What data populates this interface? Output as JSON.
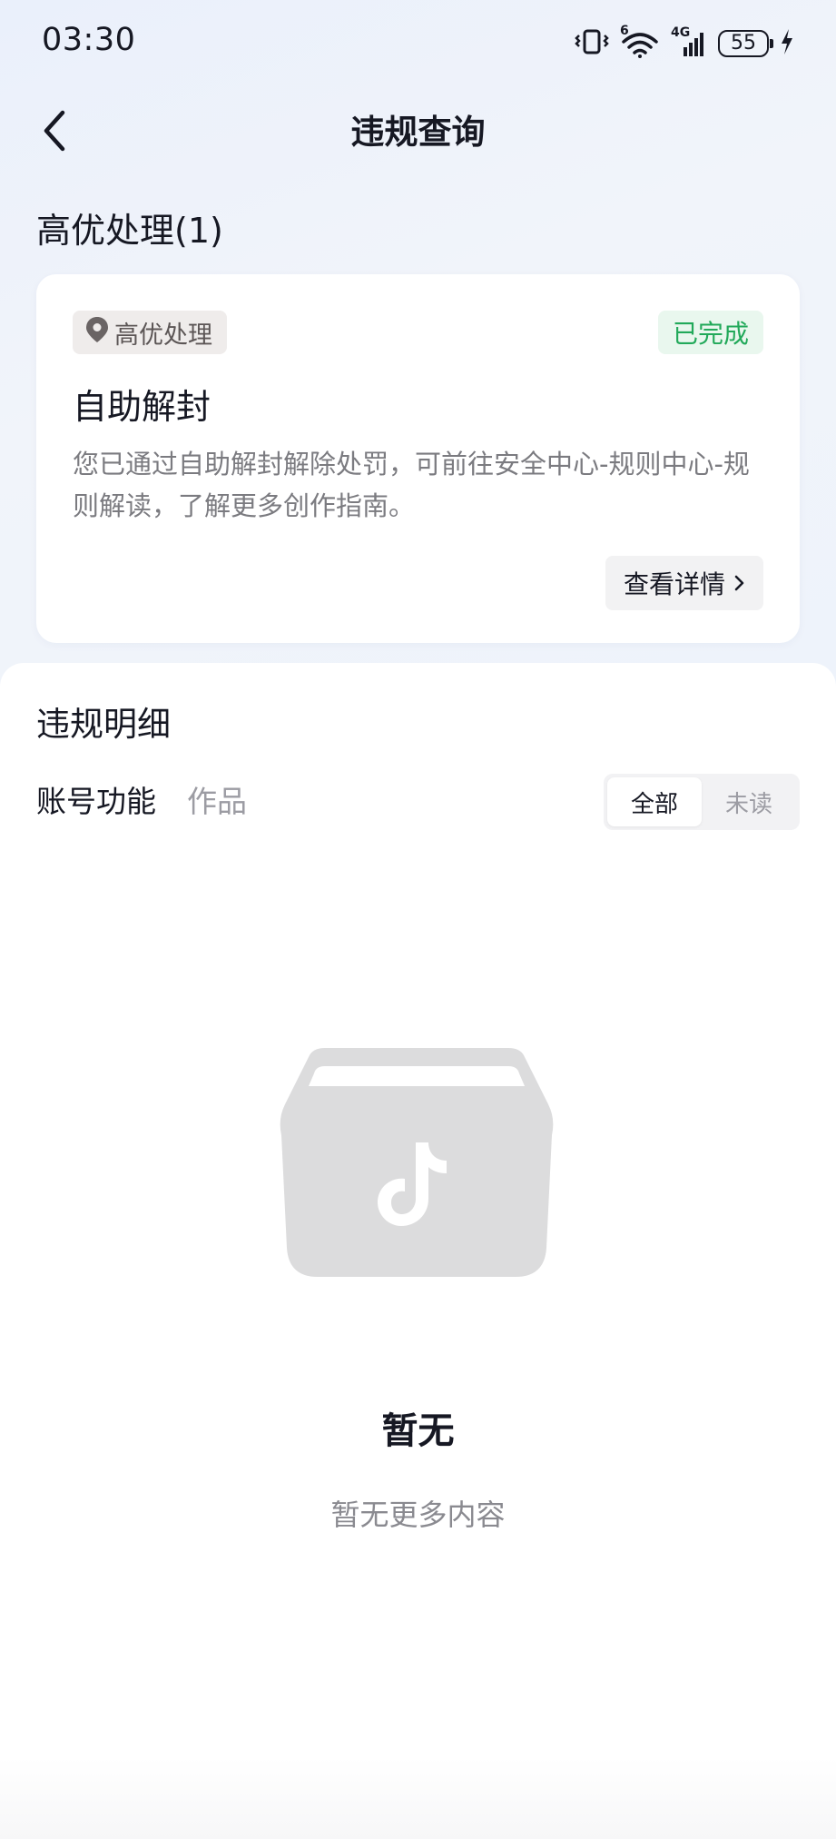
{
  "status_bar": {
    "time": "03:30",
    "signal_label": "4G",
    "wifi_label": "6",
    "battery": "55",
    "icons": [
      "vibrate-icon",
      "wifi-icon",
      "cellular-signal-icon",
      "battery-icon",
      "charging-icon"
    ]
  },
  "header": {
    "back_icon": "chevron-left-icon",
    "title": "违规查询"
  },
  "priority_section": {
    "title": "高优处理(1)",
    "card": {
      "tag_icon": "location-pin-icon",
      "tag": "高优处理",
      "status": "已完成",
      "status_color": "#22a95a",
      "heading": "自助解封",
      "description": "您已通过自助解封解除处罚，可前往安全中心-规则中心-规则解读，了解更多创作指南。",
      "detail_button": "查看详情",
      "detail_icon": "chevron-right-icon"
    }
  },
  "details_section": {
    "title": "违规明细",
    "tabs": [
      {
        "label": "账号功能",
        "active": true
      },
      {
        "label": "作品",
        "active": false
      }
    ],
    "filter": [
      {
        "label": "全部",
        "active": true
      },
      {
        "label": "未读",
        "active": false
      }
    ],
    "empty": {
      "illustration_icon": "empty-box-tiktok-icon",
      "title": "暂无",
      "subtitle": "暂无更多内容"
    }
  }
}
